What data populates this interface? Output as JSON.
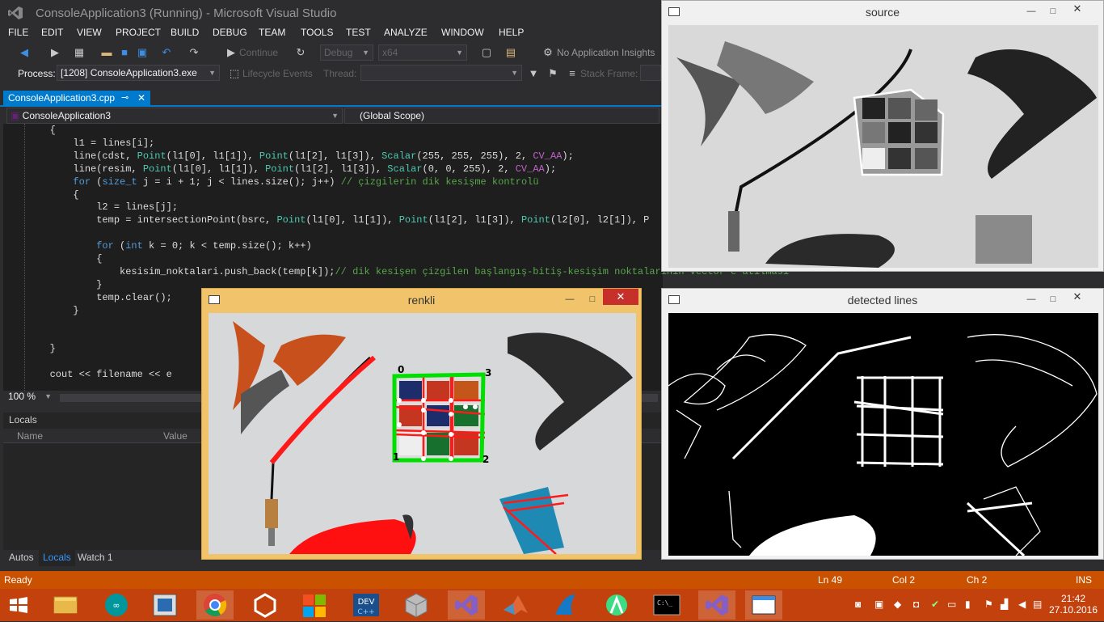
{
  "vs": {
    "title": "ConsoleApplication3 (Running) - Microsoft Visual Studio",
    "menu": [
      "FILE",
      "EDIT",
      "VIEW",
      "PROJECT",
      "BUILD",
      "DEBUG",
      "TEAM",
      "TOOLS",
      "TEST",
      "ANALYZE",
      "WINDOW",
      "HELP"
    ],
    "toolbar": {
      "continue_label": "Continue",
      "config": "Debug",
      "platform": "x64",
      "insights": "No Application Insights"
    },
    "debug_bar": {
      "process_label": "Process:",
      "process_value": "[1208] ConsoleApplication3.exe",
      "lifecycle": "Lifecycle Events",
      "thread_label": "Thread:",
      "stackframe_label": "Stack Frame:"
    },
    "doc_tab": "ConsoleApplication3.cpp",
    "nav": {
      "project": "ConsoleApplication3",
      "scope": "(Global Scope)"
    },
    "code": [
      {
        "t": "        {",
        "cls": ""
      },
      {
        "t": "            l1 = lines[i];",
        "cls": ""
      },
      {
        "t": "            line(cdst, Point(l1[0], l1[1]), Point(l1[2], l1[3]), Scalar(255, 255, 255), 2, CV_AA);",
        "cls": ""
      },
      {
        "t": "            line(resim, Point(l1[0], l1[1]), Point(l1[2], l1[3]), Scalar(0, 0, 255), 2, CV_AA);",
        "cls": ""
      },
      {
        "t": "            for (size_t j = i + 1; j < lines.size(); j++) // çizgilerin dik kesişme kontrolü",
        "cls": ""
      },
      {
        "t": "            {",
        "cls": ""
      },
      {
        "t": "                l2 = lines[j];",
        "cls": ""
      },
      {
        "t": "                temp = intersectionPoint(bsrc, Point(l1[0], l1[1]), Point(l1[2], l1[3]), Point(l2[0], l2[1]), P",
        "cls": ""
      },
      {
        "t": "",
        "cls": ""
      },
      {
        "t": "                for (int k = 0; k < temp.size(); k++)",
        "cls": ""
      },
      {
        "t": "                {",
        "cls": ""
      },
      {
        "t": "                    kesisim_noktalari.push_back(temp[k]);// dik kesişen çizgilen başlangış-bitiş-kesişim noktalarının vector'e atılması",
        "cls": ""
      },
      {
        "t": "                }",
        "cls": ""
      },
      {
        "t": "                temp.clear();",
        "cls": ""
      },
      {
        "t": "            }",
        "cls": ""
      },
      {
        "t": "",
        "cls": ""
      },
      {
        "t": "",
        "cls": ""
      },
      {
        "t": "        }",
        "cls": ""
      },
      {
        "t": "",
        "cls": ""
      },
      {
        "t": "        cout << filename << e",
        "cls": ""
      }
    ],
    "zoom": "100 %",
    "locals": {
      "title": "Locals",
      "col_name": "Name",
      "col_value": "Value"
    },
    "bottom_tabs": [
      "Autos",
      "Locals",
      "Watch 1"
    ],
    "status": {
      "ready": "Ready",
      "ln": "Ln 49",
      "col": "Col 2",
      "ch": "Ch 2",
      "ins": "INS"
    }
  },
  "windows": {
    "source": "source",
    "detected": "detected lines",
    "renkli": "renkli",
    "corner_labels": [
      "0",
      "1",
      "2",
      "3"
    ]
  },
  "clock": {
    "time": "21:42",
    "date": "27.10.2016"
  },
  "colors": {
    "accent": "#007acc",
    "status": "#ca5100",
    "taskbar": "#c2410c"
  }
}
